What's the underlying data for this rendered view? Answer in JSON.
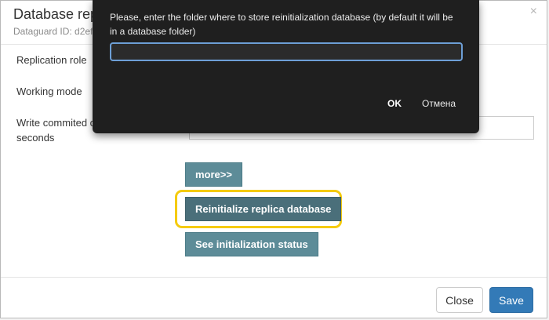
{
  "dialog": {
    "title": "Database repl",
    "subtitle": "Dataguard ID: d2ef",
    "close_glyph": "×",
    "fields": {
      "replication_role": "Replication role",
      "working_mode": "Working mode",
      "write_commited": "Write commited o seconds"
    },
    "buttons": {
      "more": "more>>",
      "reinitialize": "Reinitialize replica database",
      "see_status": "See initialization status"
    },
    "footer": {
      "close": "Close",
      "save": "Save"
    },
    "colors": {
      "teal_button": "#5d8c98",
      "highlight": "#f5cb0e",
      "primary": "#337ab7"
    }
  },
  "prompt": {
    "message": "Please, enter the folder where to store reinitialization database (by default it will be in a database folder)",
    "input_value": "",
    "ok": "OK",
    "cancel": "Отмена"
  }
}
